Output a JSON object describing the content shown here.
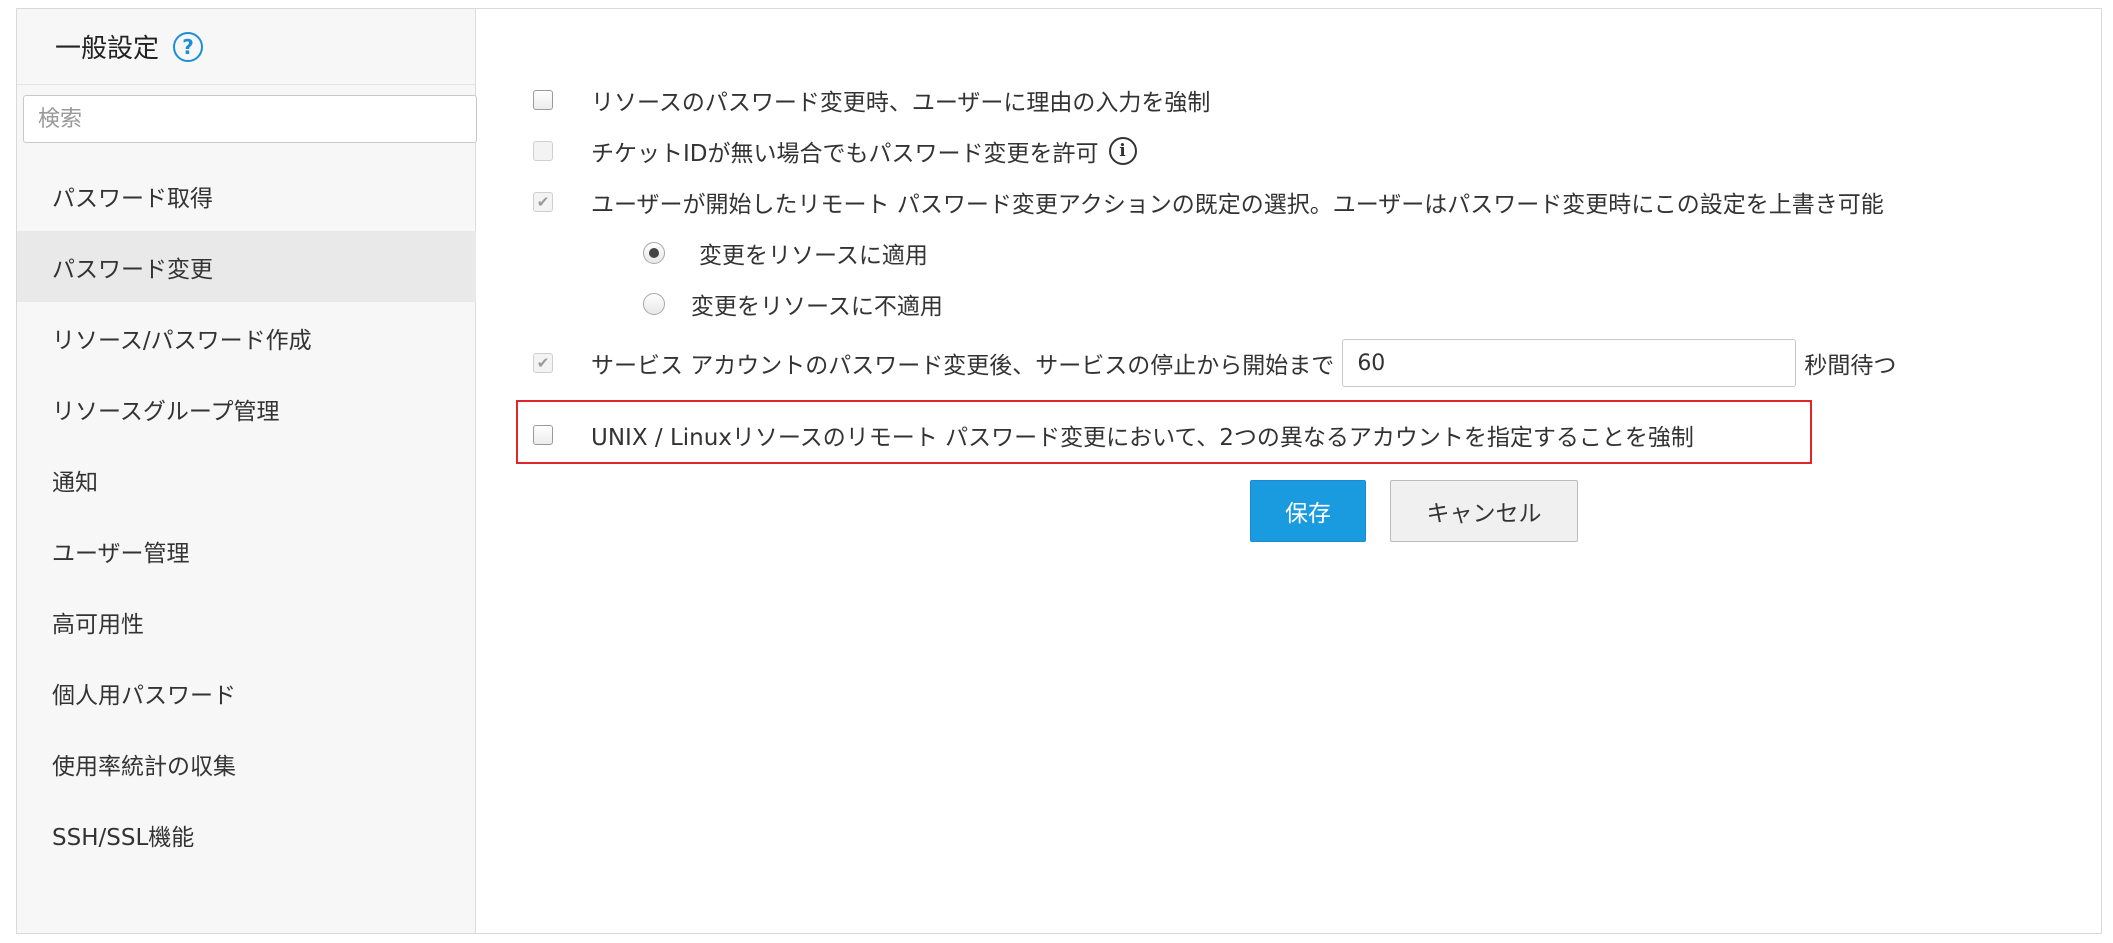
{
  "sidebar": {
    "title": "一般設定",
    "help_icon": "?",
    "search_placeholder": "検索",
    "items": [
      {
        "label": "パスワード取得"
      },
      {
        "label": "パスワード変更",
        "active": true
      },
      {
        "label": "リソース/パスワード作成"
      },
      {
        "label": "リソースグループ管理"
      },
      {
        "label": "通知"
      },
      {
        "label": "ユーザー管理"
      },
      {
        "label": "高可用性"
      },
      {
        "label": "個人用パスワード"
      },
      {
        "label": "使用率統計の収集"
      },
      {
        "label": "SSH/SSL機能"
      }
    ]
  },
  "settings": {
    "enforce_reason": {
      "label": "リソースのパスワード変更時、ユーザーに理由の入力を強制",
      "checked": false
    },
    "allow_without_ticket": {
      "label": "チケットIDが無い場合でもパスワード変更を許可",
      "checked": false,
      "info_icon": "i"
    },
    "default_remote_action": {
      "label": "ユーザーが開始したリモート パスワード変更アクションの既定の選択。ユーザーはパスワード変更時にこの設定を上書き可能",
      "checked": true
    },
    "apply_option": {
      "label": "変更をリソースに適用",
      "selected": true
    },
    "not_apply_option": {
      "label": "変更をリソースに不適用",
      "selected": false
    },
    "service_wait": {
      "label_before": "サービス アカウントのパスワード変更後、サービスの停止から開始まで",
      "value": "60",
      "label_after": "秒間待つ",
      "checked": true
    },
    "unix_two_accounts": {
      "label": "UNIX / Linuxリソースのリモート パスワード変更において、2つの異なるアカウントを指定することを強制",
      "checked": false
    }
  },
  "buttons": {
    "save": "保存",
    "cancel": "キャンセル"
  },
  "colors": {
    "accent": "#1a9be0",
    "highlight_border": "#e0252b"
  }
}
